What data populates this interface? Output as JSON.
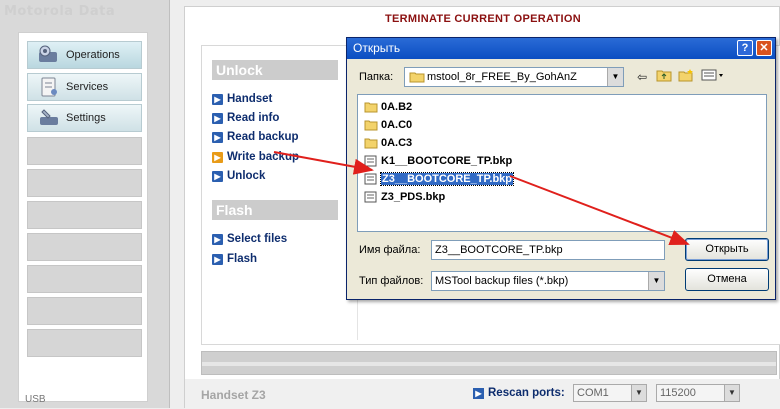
{
  "app": {
    "title": "Motorola Data",
    "connection": "USB"
  },
  "sidebar": {
    "items": [
      {
        "label": "Operations",
        "icon": "operations-icon",
        "active": true
      },
      {
        "label": "Services",
        "icon": "services-icon",
        "active": false
      },
      {
        "label": "Settings",
        "icon": "settings-icon",
        "active": false
      }
    ]
  },
  "main": {
    "terminate_label": "TERMINATE CURRENT OPERATION",
    "groups": {
      "unlock": {
        "title": "Unlock",
        "items": [
          "Handset",
          "Read info",
          "Read backup",
          "Write backup",
          "Unlock"
        ],
        "selected": "Write backup"
      },
      "flash": {
        "title": "Flash",
        "items": [
          "Select files",
          "Flash"
        ]
      }
    }
  },
  "status": {
    "handset": "Handset Z3",
    "rescan_label": "Rescan ports:",
    "port": "COM1",
    "baud": "115200"
  },
  "dialog": {
    "title": "Открыть",
    "lookin_label": "Папка:",
    "lookin_value": "mstool_8r_FREE_By_GohAnZ",
    "files": [
      {
        "name": "0A.B2",
        "type": "folder"
      },
      {
        "name": "0A.C0",
        "type": "folder"
      },
      {
        "name": "0A.C3",
        "type": "folder"
      },
      {
        "name": "K1__BOOTCORE_TP.bkp",
        "type": "file"
      },
      {
        "name": "Z3__BOOTCORE_TP.bkp",
        "type": "file",
        "selected": true
      },
      {
        "name": "Z3_PDS.bkp",
        "type": "file"
      }
    ],
    "filename_label": "Имя файла:",
    "filename_value": "Z3__BOOTCORE_TP.bkp",
    "filetype_label": "Тип файлов:",
    "filetype_value": "MSTool backup files (*.bkp)",
    "open_button": "Открыть",
    "cancel_button": "Отмена",
    "help_glyph": "?",
    "close_glyph": "✕"
  },
  "colors": {
    "accent_blue": "#2b5fb0",
    "selected_orange": "#e89b18",
    "terminate_red": "#8b1010",
    "annotation_red": "#e0201c",
    "dialog_titlebar": "#0b4ec2",
    "selection_blue": "#316ac5"
  }
}
